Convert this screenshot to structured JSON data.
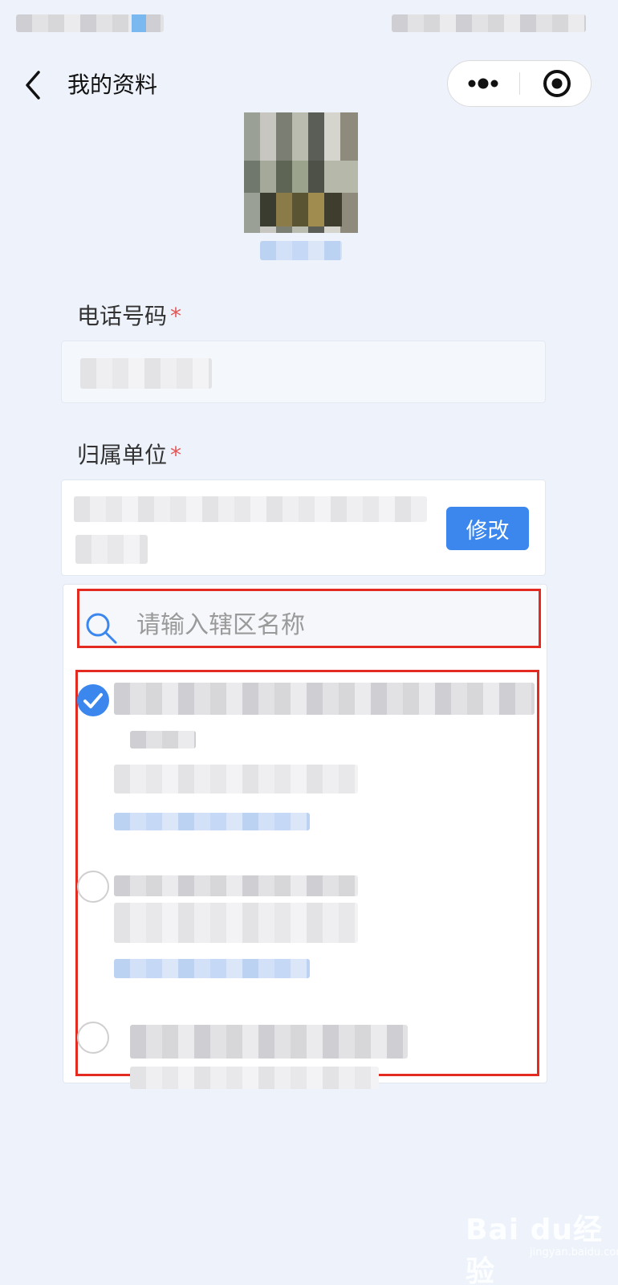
{
  "nav": {
    "title": "我的资料"
  },
  "form": {
    "phone": {
      "label": "电话号码",
      "required_mark": "*"
    },
    "unit": {
      "label": "归属单位",
      "required_mark": "*",
      "edit_button_label": "修改"
    }
  },
  "dropdown": {
    "search": {
      "placeholder": "请输入辖区名称",
      "value": ""
    },
    "items": [
      {
        "selected": true
      },
      {
        "selected": false
      },
      {
        "selected": false
      }
    ]
  },
  "watermark": {
    "brand": "Bai du经验",
    "url": "jingyan.baidu.com"
  },
  "colors": {
    "accent": "#3b87ee",
    "required": "#e55656",
    "highlight_frame": "#e32b21",
    "background": "#eef3fb"
  },
  "icons": {
    "back": "chevron-left-icon",
    "more": "more-dots-icon",
    "close": "target-close-icon",
    "search": "search-icon",
    "checked": "check-circle-icon",
    "unchecked": "empty-circle-icon"
  }
}
